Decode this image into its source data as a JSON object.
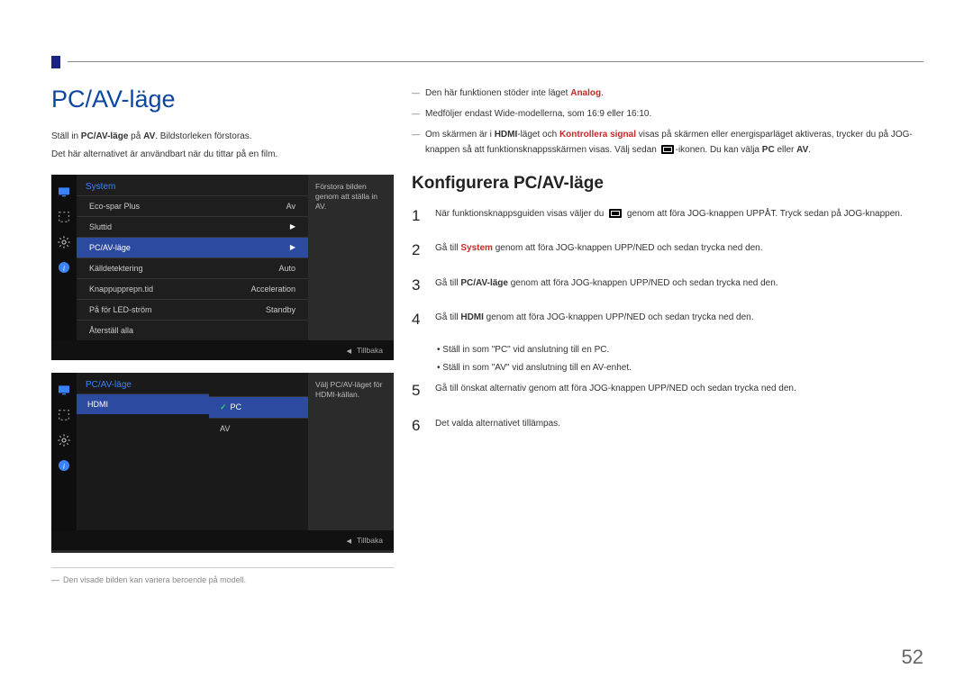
{
  "page_number": "52",
  "heading": "PC/AV-läge",
  "intro1_a": "Ställ in ",
  "intro1_b": "PC/AV-läge",
  "intro1_c": " på ",
  "intro1_d": "AV",
  "intro1_e": ". Bildstorleken förstoras.",
  "intro2": "Det här alternativet är användbart när du tittar på en film.",
  "osd1": {
    "title": "System",
    "items": [
      {
        "label": "Eco-spar Plus",
        "value": "Av"
      },
      {
        "label": "Sluttid",
        "value": "▶"
      },
      {
        "label": "PC/AV-läge",
        "value": "▶",
        "selected": true
      },
      {
        "label": "Källdetektering",
        "value": "Auto"
      },
      {
        "label": "Knappupprepn.tid",
        "value": "Acceleration"
      },
      {
        "label": "På för LED-ström",
        "value": "Standby"
      },
      {
        "label": "Återställ alla",
        "value": ""
      }
    ],
    "help": "Förstora bilden genom att ställa in AV.",
    "foot": "Tillbaka"
  },
  "osd2": {
    "title": "PC/AV-läge",
    "item": "HDMI",
    "opts": [
      {
        "label": "PC",
        "selected": true,
        "check": true
      },
      {
        "label": "AV"
      }
    ],
    "help": "Välj PC/AV-läget för HDMI-källan.",
    "foot": "Tillbaka"
  },
  "footnote_dash": "―",
  "footnote": "Den visade bilden kan variera beroende på modell.",
  "notes": {
    "n1_a": "Den här funktionen stöder inte läget ",
    "n1_b": "Analog",
    "n1_c": ".",
    "n2": "Medföljer endast Wide-modellerna, som 16:9 eller 16:10.",
    "n3_a": "Om skärmen är i ",
    "n3_b": "HDMI",
    "n3_c": "-läget och ",
    "n3_d": "Kontrollera signal",
    "n3_e": " visas på skärmen eller energisparläget aktiveras, trycker du på JOG-knappen så att funktionsknappsskärmen visas. Välj sedan ",
    "n3_f": "-ikonen. Du kan välja ",
    "n3_g": "PC",
    "n3_h": " eller ",
    "n3_i": "AV",
    "n3_j": "."
  },
  "subheading": "Konfigurera PC/AV-läge",
  "steps": {
    "s1_a": "När funktionsknappsguiden visas väljer du ",
    "s1_b": " genom att föra JOG-knappen UPPÅT. Tryck sedan på JOG-knappen.",
    "s2_a": "Gå till ",
    "s2_b": "System",
    "s2_c": " genom att föra JOG-knappen UPP/NED och sedan trycka ned den.",
    "s3_a": "Gå till ",
    "s3_b": "PC/AV-läge",
    "s3_c": " genom att föra JOG-knappen UPP/NED och sedan trycka ned den.",
    "s4_a": "Gå till ",
    "s4_b": "HDMI",
    "s4_c": " genom att föra JOG-knappen UPP/NED och sedan trycka ned den.",
    "b1": "Ställ in som \"PC\" vid anslutning till en PC.",
    "b2": "Ställ in som \"AV\" vid anslutning till en AV-enhet.",
    "s5": "Gå till önskat alternativ genom att föra JOG-knappen UPP/NED och sedan trycka ned den.",
    "s6": "Det valda alternativet tillämpas."
  },
  "nums": {
    "1": "1",
    "2": "2",
    "3": "3",
    "4": "4",
    "5": "5",
    "6": "6"
  }
}
